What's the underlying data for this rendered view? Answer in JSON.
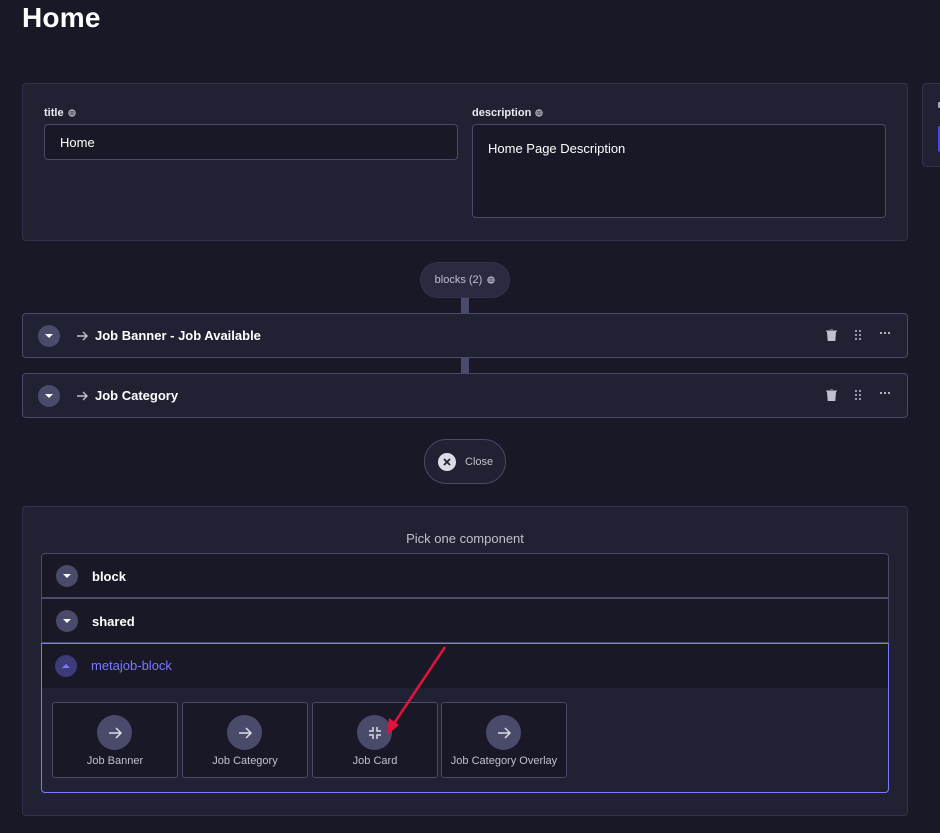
{
  "page": {
    "title": "Home"
  },
  "fields": {
    "title": {
      "label": "title",
      "value": "Home",
      "icon": "globe-icon"
    },
    "description": {
      "label": "description",
      "value": "Home Page Description",
      "icon": "globe-icon"
    }
  },
  "blocks": {
    "pill_label": "blocks (2)",
    "items": [
      {
        "title": "Job Banner - Job Available"
      },
      {
        "title": "Job Category"
      }
    ]
  },
  "close_button": {
    "label": "Close"
  },
  "picker": {
    "title": "Pick one component",
    "groups": [
      {
        "label": "block",
        "expanded": false
      },
      {
        "label": "shared",
        "expanded": false
      },
      {
        "label": "metajob-block",
        "expanded": true
      }
    ],
    "components": [
      {
        "label": "Job Banner",
        "icon": "arrow-right-icon"
      },
      {
        "label": "Job Category",
        "icon": "arrow-right-icon"
      },
      {
        "label": "Job Card",
        "icon": "collapse-icon"
      },
      {
        "label": "Job Category Overlay",
        "icon": "arrow-right-icon"
      }
    ]
  },
  "colors": {
    "background": "#181826",
    "panel": "#212134",
    "border": "#4a4a6a",
    "accent": "#7b79ff",
    "primary": "#4945ff",
    "annotation_arrow": "#e0143c"
  }
}
